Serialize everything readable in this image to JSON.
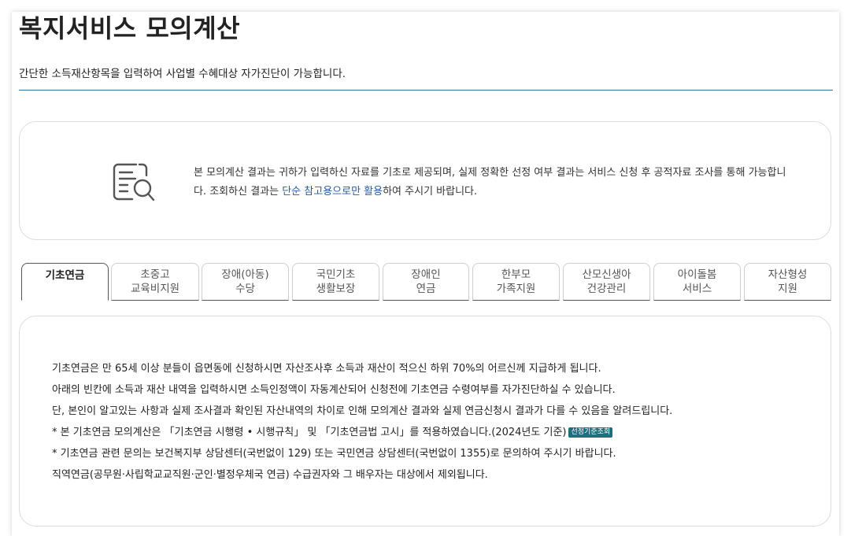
{
  "page": {
    "title": "복지서비스 모의계산",
    "subtitle": "간단한 소득재산항목을 입력하여 사업별 수혜대상 자가진단이 가능합니다."
  },
  "notice": {
    "icon": "document-search-icon",
    "text_before": "본 모의계산 결과는 귀하가 입력하신 자료를 기초로 제공되며, 실제 정확한 선정 여부 결과는 서비스 신청 후 공적자료 조사를 통해 가능합니다. 조회하신 결과는 ",
    "highlight": "단순 참고용으로만 활용",
    "text_after": "하여 주시기 바랍니다.",
    "highlight_color": "#2c5aa0"
  },
  "tabs": [
    {
      "line1": "기초연금",
      "line2": "",
      "active": true
    },
    {
      "line1": "초중고",
      "line2": "교육비지원",
      "active": false
    },
    {
      "line1": "장애(아동)",
      "line2": "수당",
      "active": false
    },
    {
      "line1": "국민기초",
      "line2": "생활보장",
      "active": false
    },
    {
      "line1": "장애인",
      "line2": "연금",
      "active": false
    },
    {
      "line1": "한부모",
      "line2": "가족지원",
      "active": false
    },
    {
      "line1": "산모신생아",
      "line2": "건강관리",
      "active": false
    },
    {
      "line1": "아이돌봄",
      "line2": "서비스",
      "active": false
    },
    {
      "line1": "자산형성",
      "line2": "지원",
      "active": false
    }
  ],
  "content": {
    "lines": [
      "기초연금은 만 65세 이상 분들이 읍면동에 신청하시면 자산조사후 소득과 재산이 적으신 하위 70%의 어르신께 지급하게 됩니다.",
      "아래의 빈칸에 소득과 재산 내역을 입력하시면 소득인정액이 자동계산되어 신청전에 기초연금 수령여부를 자가진단하실 수 있습니다.",
      "단, 본인이 알고있는 사항과 실제 조사결과 확인된 자산내역의 차이로 인해 모의계산 결과와 실제 연금신청시 결과가 다를 수 있음을 알려드립니다.",
      "* 본 기초연금 모의계산은 「기초연금 시행령 • 시행규칙」 및 「기초연금법 고시」를 적용하였습니다.(2024년도 기준)",
      "* 기초연금 관련 문의는 보건복지부 상담센터(국번없이 129) 또는 국민연금 상담센터(국번없이 1355)로 문의하여 주시기 바랍니다.",
      "직역연금(공무원·사립학교교직원·군인·별정우체국 연금) 수급권자와 그 배우자는 대상에서 제외됩니다."
    ],
    "badge": "선정기준조회",
    "badge_color": "#1b6f7e"
  }
}
